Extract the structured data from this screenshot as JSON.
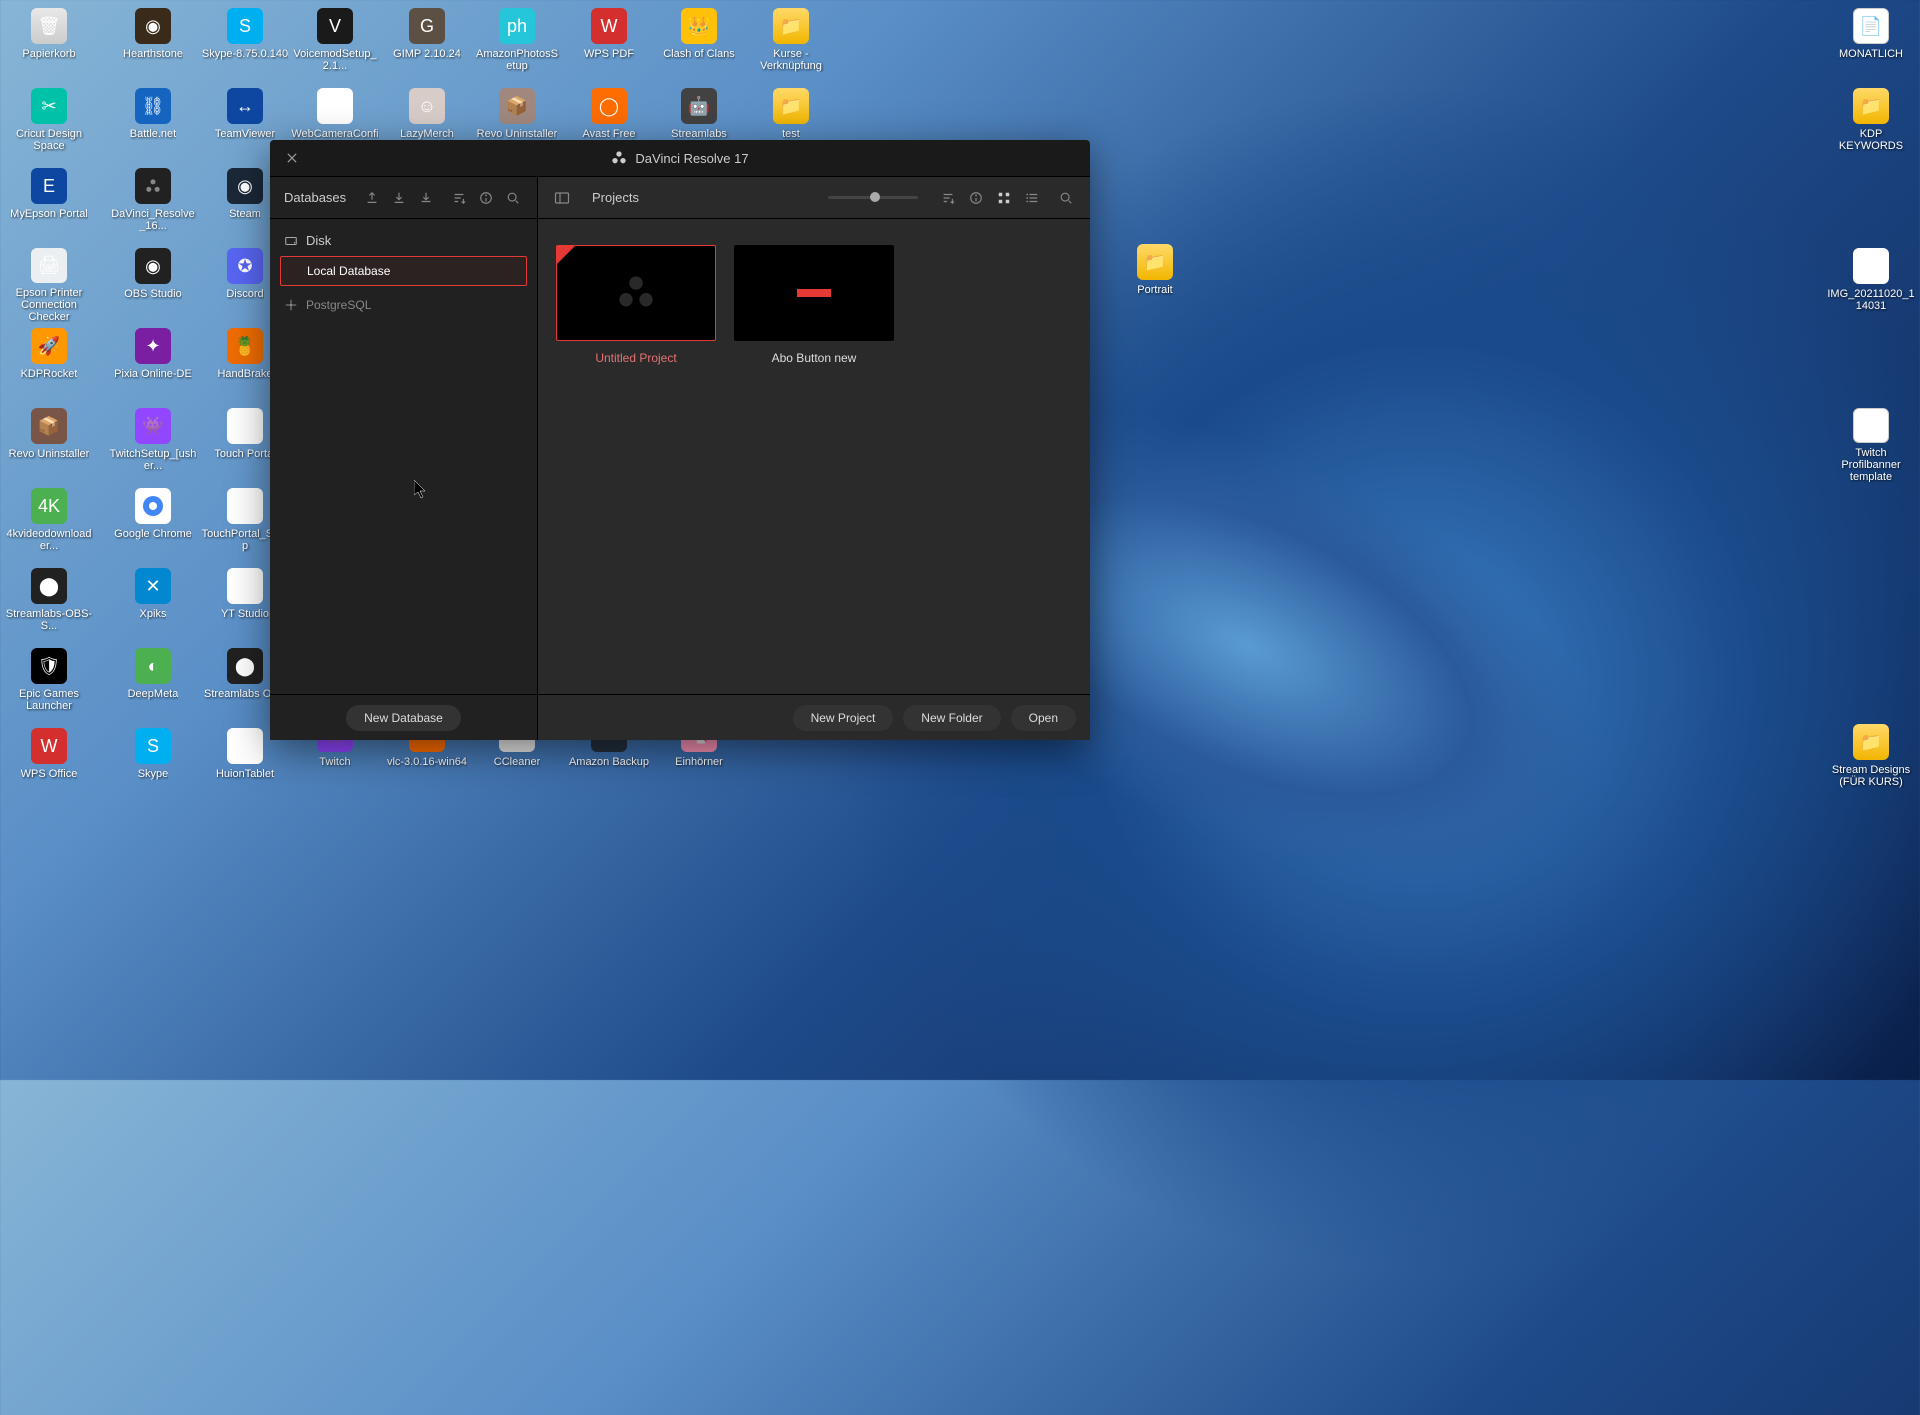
{
  "window": {
    "title": "DaVinci Resolve 17"
  },
  "sidebar": {
    "headerLabel": "Databases",
    "groups": {
      "disk": {
        "label": "Disk"
      },
      "postgres": {
        "label": "PostgreSQL"
      }
    },
    "items": {
      "localDatabase": {
        "label": "Local Database"
      }
    },
    "footer": {
      "newDatabase": "New Database"
    }
  },
  "main": {
    "headerLabel": "Projects",
    "projects": [
      {
        "name": "Untitled Project",
        "selected": true,
        "hasCorner": true,
        "kind": "blank"
      },
      {
        "name": "Abo Button new",
        "selected": false,
        "hasCorner": false,
        "kind": "preview"
      }
    ],
    "footer": {
      "newProject": "New Project",
      "newFolder": "New Folder",
      "open": "Open"
    }
  },
  "desktop": {
    "col1": [
      "Papierkorb",
      "Cricut Design Space",
      "MyEpson Portal",
      "Epson Printer Connection Checker",
      "KDPRocket",
      "Revo Uninstaller",
      "4kvideodownloader...",
      "Streamlabs-OBS-S...",
      "Epic Games Launcher",
      "WPS Office"
    ],
    "col2": [
      "Hearthstone",
      "Battle.net",
      "DaVinci_Resolve_16...",
      "OBS Studio",
      "Pixia Online-DE",
      "TwitchSetup_[usher...",
      "Google Chrome",
      "Xpiks",
      "DeepMeta",
      "Skype"
    ],
    "col3": [
      "Skype-8.75.0.140",
      "TeamViewer",
      "Steam",
      "Discord",
      "HandBrake",
      "Touch Portal",
      "TouchPortal_Setup",
      "YT Studio",
      "Streamlabs OBS",
      "HuionTablet"
    ],
    "col4": [
      "VoicemodSetup_2.1...",
      "WebCameraConfig",
      "",
      "",
      "",
      "",
      "",
      "",
      "",
      "Twitch"
    ],
    "col5": [
      "GIMP 2.10.24",
      "LazyMerch",
      "",
      "",
      "",
      "",
      "",
      "",
      "",
      "vlc-3.0.16-win64"
    ],
    "col6": [
      "AmazonPhotosSetup",
      "Revo Uninstaller",
      "",
      "",
      "",
      "",
      "",
      "",
      "",
      "CCleaner"
    ],
    "col7": [
      "WPS PDF",
      "Avast Free Antivirus",
      "",
      "",
      "",
      "",
      "",
      "",
      "",
      "Amazon Backup"
    ],
    "col8": [
      "Clash of Clans",
      "Streamlabs Chatbot",
      "",
      "",
      "",
      "",
      "",
      "",
      "",
      "Einhörner"
    ],
    "col9": [
      "Kurse - Verknüpfung",
      "test"
    ],
    "colMid": [
      "Portrait"
    ],
    "colR1": [
      "MONATLICH",
      "KDP KEYWORDS",
      "",
      "IMG_20211020_114031",
      "",
      "Twitch Profilbanner template",
      "",
      "",
      "",
      "Stream Designs (FÜR KURS)"
    ]
  }
}
